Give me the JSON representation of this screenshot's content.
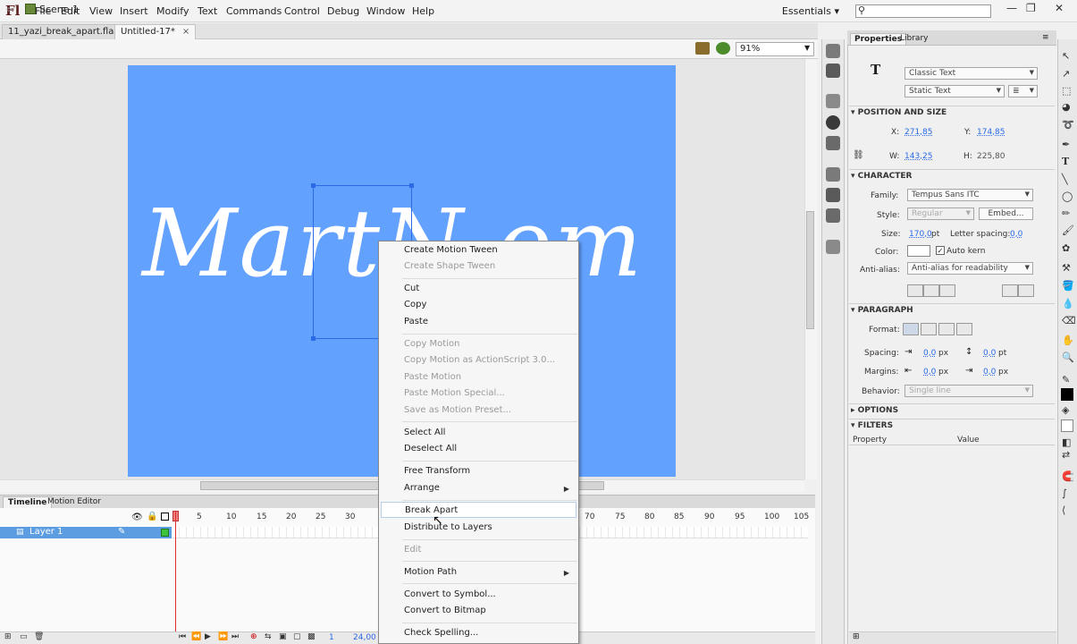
{
  "app": {
    "logo": "Fl",
    "menu": [
      "File",
      "Edit",
      "View",
      "Insert",
      "Modify",
      "Text",
      "Commands",
      "Control",
      "Debug",
      "Window",
      "Help"
    ],
    "workspace": "Essentials",
    "window_controls": {
      "minimize": "—",
      "maximize": "❐",
      "close": "✕"
    }
  },
  "doc_tabs": [
    {
      "label": "11_yazi_break_apart.fla",
      "close": "×"
    },
    {
      "label": "Untitled-17*",
      "close": "×"
    }
  ],
  "editbar": {
    "scene": "Scene 1",
    "zoom": "91%"
  },
  "stage": {
    "text": "MartN om",
    "background": "#63a1ff"
  },
  "context_menu": {
    "groups": [
      [
        {
          "label": "Create Motion Tween",
          "enabled": true
        },
        {
          "label": "Create Shape Tween",
          "enabled": false
        }
      ],
      [
        {
          "label": "Cut",
          "enabled": true
        },
        {
          "label": "Copy",
          "enabled": true
        },
        {
          "label": "Paste",
          "enabled": true
        }
      ],
      [
        {
          "label": "Copy Motion",
          "enabled": false
        },
        {
          "label": "Copy Motion as ActionScript 3.0...",
          "enabled": false
        },
        {
          "label": "Paste Motion",
          "enabled": false
        },
        {
          "label": "Paste Motion Special...",
          "enabled": false
        },
        {
          "label": "Save as Motion Preset...",
          "enabled": false
        }
      ],
      [
        {
          "label": "Select All",
          "enabled": true
        },
        {
          "label": "Deselect All",
          "enabled": true
        }
      ],
      [
        {
          "label": "Free Transform",
          "enabled": true
        },
        {
          "label": "Arrange",
          "enabled": true,
          "submenu": true
        }
      ],
      [
        {
          "label": "Break Apart",
          "enabled": true,
          "hover": true
        },
        {
          "label": "Distribute to Layers",
          "enabled": true
        }
      ],
      [
        {
          "label": "Edit",
          "enabled": false
        }
      ],
      [
        {
          "label": "Motion Path",
          "enabled": true,
          "submenu": true
        }
      ],
      [
        {
          "label": "Convert to Symbol...",
          "enabled": true
        },
        {
          "label": "Convert to Bitmap",
          "enabled": true
        }
      ],
      [
        {
          "label": "Check Spelling...",
          "enabled": true
        }
      ]
    ]
  },
  "timeline": {
    "tabs": [
      "Timeline",
      "Motion Editor"
    ],
    "frame_numbers": [
      "1",
      "5",
      "10",
      "15",
      "20",
      "25",
      "30",
      "70",
      "75",
      "80",
      "85",
      "90",
      "95",
      "100",
      "105"
    ],
    "layer": "Layer 1",
    "current_frame": "1",
    "fps": "24,00 fps"
  },
  "properties": {
    "tabs": [
      "Properties",
      "Library"
    ],
    "text_type": "Classic Text",
    "text_subtype": "Static Text",
    "position_size": {
      "title": "POSITION AND SIZE",
      "x_label": "X:",
      "x": "271,85",
      "y_label": "Y:",
      "y": "174,85",
      "w_label": "W:",
      "w": "143,25",
      "h_label": "H:",
      "h": "225,80"
    },
    "character": {
      "title": "CHARACTER",
      "family_label": "Family:",
      "family": "Tempus Sans ITC",
      "style_label": "Style:",
      "style": "Regular",
      "embed": "Embed...",
      "size_label": "Size:",
      "size": "170,0",
      "size_unit": "pt",
      "spacing_label": "Letter spacing:",
      "spacing": "0,0",
      "color_label": "Color:",
      "autokern": "Auto kern",
      "antialias_label": "Anti-alias:",
      "antialias": "Anti-alias for readability"
    },
    "paragraph": {
      "title": "PARAGRAPH",
      "format_label": "Format:",
      "spacing_label": "Spacing:",
      "indent": "0,0",
      "indent_unit": "px",
      "line_spacing": "0,0",
      "line_unit": "pt",
      "margins_label": "Margins:",
      "left_margin": "0,0",
      "left_unit": "px",
      "right_margin": "0,0",
      "right_unit": "px",
      "behavior_label": "Behavior:",
      "behavior": "Single line"
    },
    "options_title": "OPTIONS",
    "filters": {
      "title": "FILTERS",
      "col_property": "Property",
      "col_value": "Value"
    }
  }
}
